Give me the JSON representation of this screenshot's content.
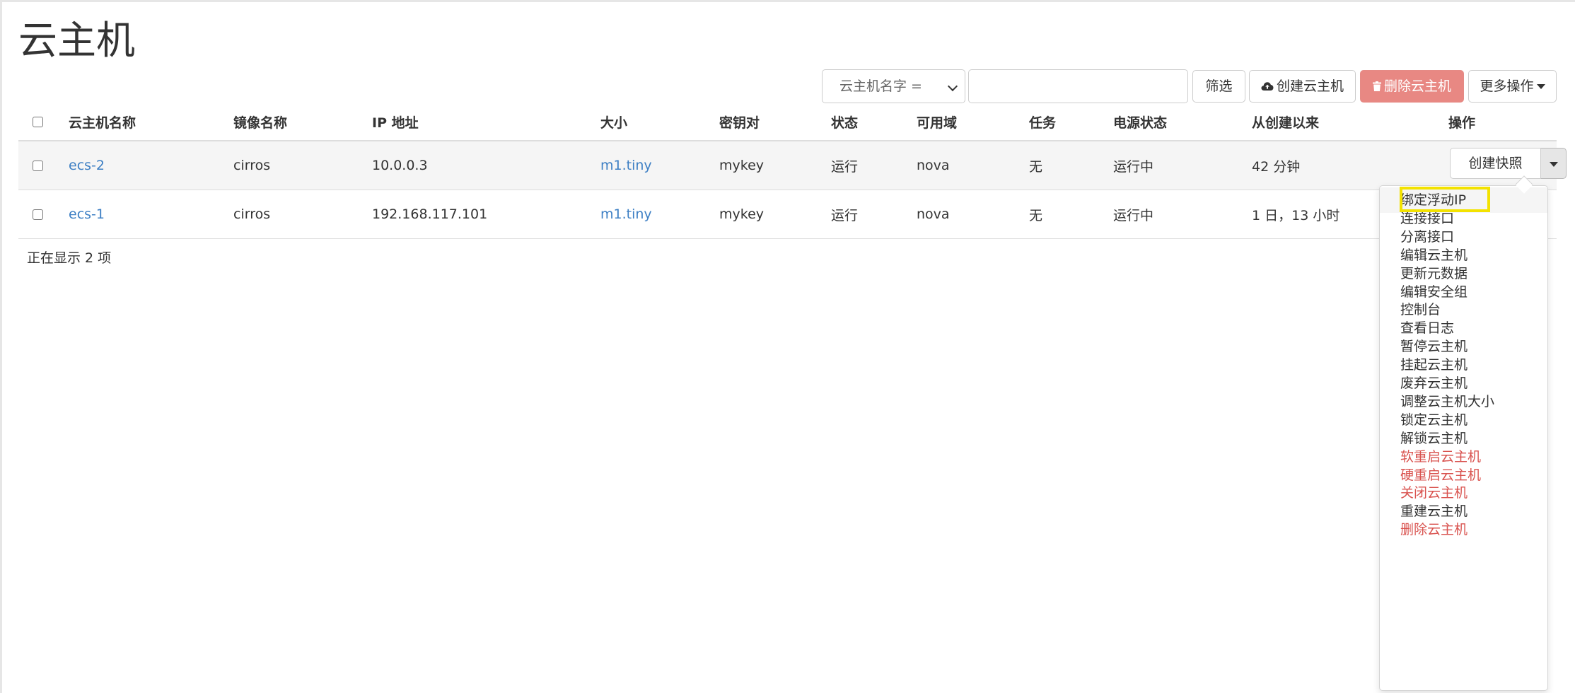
{
  "page": {
    "title": "云主机"
  },
  "toolbar": {
    "filter_field": "云主机名字 =",
    "filter_value": "",
    "filter_button": "筛选",
    "create_button": "创建云主机",
    "delete_button": "删除云主机",
    "more_button": "更多操作"
  },
  "table": {
    "headers": [
      "云主机名称",
      "镜像名称",
      "IP 地址",
      "大小",
      "密钥对",
      "状态",
      "可用域",
      "任务",
      "电源状态",
      "从创建以来",
      "操作"
    ],
    "rows": [
      {
        "name": "ecs-2",
        "image": "cirros",
        "ip": "10.0.0.3",
        "size": "m1.tiny",
        "keypair": "mykey",
        "status": "运行",
        "zone": "nova",
        "task": "无",
        "power": "运行中",
        "age": "42 分钟"
      },
      {
        "name": "ecs-1",
        "image": "cirros",
        "ip": "192.168.117.101",
        "size": "m1.tiny",
        "keypair": "mykey",
        "status": "运行",
        "zone": "nova",
        "task": "无",
        "power": "运行中",
        "age": "1 日，13 小时"
      }
    ],
    "row_action": "创建快照",
    "footer": "正在显示 2 项"
  },
  "menu": {
    "items": [
      {
        "label": "绑定浮动IP",
        "danger": false
      },
      {
        "label": "连接接口",
        "danger": false
      },
      {
        "label": "分离接口",
        "danger": false
      },
      {
        "label": "编辑云主机",
        "danger": false
      },
      {
        "label": "更新元数据",
        "danger": false
      },
      {
        "label": "编辑安全组",
        "danger": false
      },
      {
        "label": "控制台",
        "danger": false
      },
      {
        "label": "查看日志",
        "danger": false
      },
      {
        "label": "暂停云主机",
        "danger": false
      },
      {
        "label": "挂起云主机",
        "danger": false
      },
      {
        "label": "废弃云主机",
        "danger": false
      },
      {
        "label": "调整云主机大小",
        "danger": false
      },
      {
        "label": "锁定云主机",
        "danger": false
      },
      {
        "label": "解锁云主机",
        "danger": false
      },
      {
        "label": "软重启云主机",
        "danger": true
      },
      {
        "label": "硬重启云主机",
        "danger": true
      },
      {
        "label": "关闭云主机",
        "danger": true
      },
      {
        "label": "重建云主机",
        "danger": false
      },
      {
        "label": "删除云主机",
        "danger": true
      }
    ]
  },
  "icons": {
    "create": "cloud-upload-icon",
    "delete": "trash-icon",
    "caret": "caret-down-icon"
  },
  "colors": {
    "link": "#3d7fc4",
    "danger": "#d9534f",
    "delete_button_bg": "#e88883",
    "highlight_box": "#f3e200"
  }
}
